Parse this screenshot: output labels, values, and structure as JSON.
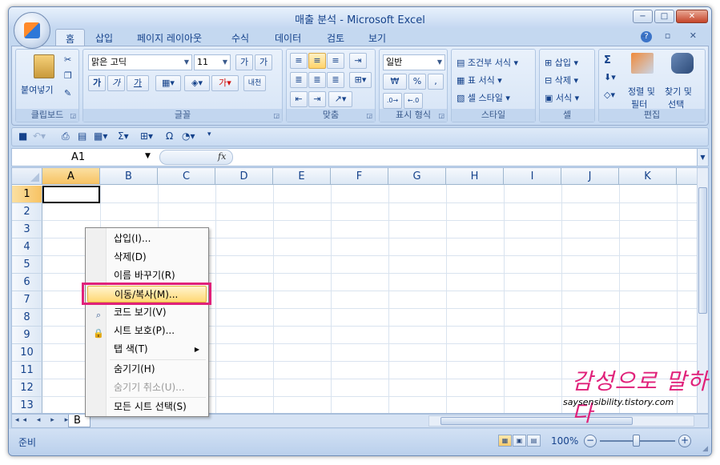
{
  "window": {
    "title": "매출 분석 - Microsoft Excel",
    "buttons": {
      "minimize": "−",
      "maximize": "□",
      "close": "✕"
    }
  },
  "ribbon_tabs": [
    "홈",
    "삽입",
    "페이지 레이아웃",
    "수식",
    "데이터",
    "검토",
    "보기"
  ],
  "ribbon_tab_minis": "– ▫ ✕",
  "ribbon": {
    "clipboard": {
      "paste": "붙여넣기",
      "label": "클립보드"
    },
    "font": {
      "name": "맑은 고딕",
      "size": "11",
      "bold": "가",
      "italic": "가",
      "underline": "가",
      "label": "글꼴",
      "phonetic": "내천"
    },
    "alignment": {
      "label": "맞춤"
    },
    "number": {
      "format": "일반",
      "currency": "₩",
      "percent": "%",
      "comma": ",",
      "label": "표시 형식"
    },
    "styles": {
      "conditional": "조건부 서식",
      "table": "표 서식",
      "cell": "셀 스타일",
      "label": "스타일"
    },
    "cells": {
      "insert": "삽입",
      "delete": "삭제",
      "format": "서식",
      "label": "셀"
    },
    "editing": {
      "sum": "Σ",
      "sort": "정렬 및",
      "sort2": "필터",
      "find": "찾기 및",
      "find2": "선택",
      "label": "편집"
    }
  },
  "formula_bar": {
    "name_box": "A1",
    "fx": "fx"
  },
  "columns": [
    "A",
    "B",
    "C",
    "D",
    "E",
    "F",
    "G",
    "H",
    "I",
    "J",
    "K"
  ],
  "rows": [
    "1",
    "2",
    "3",
    "4",
    "5",
    "6",
    "7",
    "8",
    "9",
    "10",
    "11",
    "12",
    "13"
  ],
  "sheet_tab": "B",
  "sheet_nav": "◂◂ ◂ ▸ ▸▸",
  "status": {
    "text": "준비",
    "zoom": "100%"
  },
  "context_menu": {
    "items": [
      {
        "label": "삽입(I)..."
      },
      {
        "label": "삭제(D)"
      },
      {
        "label": "이름 바꾸기(R)"
      },
      {
        "label": "이동/복사(M)..."
      },
      {
        "label": "코드 보기(V)"
      },
      {
        "label": "시트 보호(P)..."
      },
      {
        "label": "탭 색(T)"
      },
      {
        "label": "숨기기(H)"
      },
      {
        "label": "숨기기 취소(U)..."
      },
      {
        "label": "모든 시트 선택(S)"
      }
    ]
  },
  "watermark": {
    "line1": "감성으로 말하다",
    "line2": "saysensibility.tistory.com"
  },
  "colors": {
    "highlight": "#e0217a",
    "ribbon": "#d2e2f6",
    "frame": "#c4d8f0"
  }
}
